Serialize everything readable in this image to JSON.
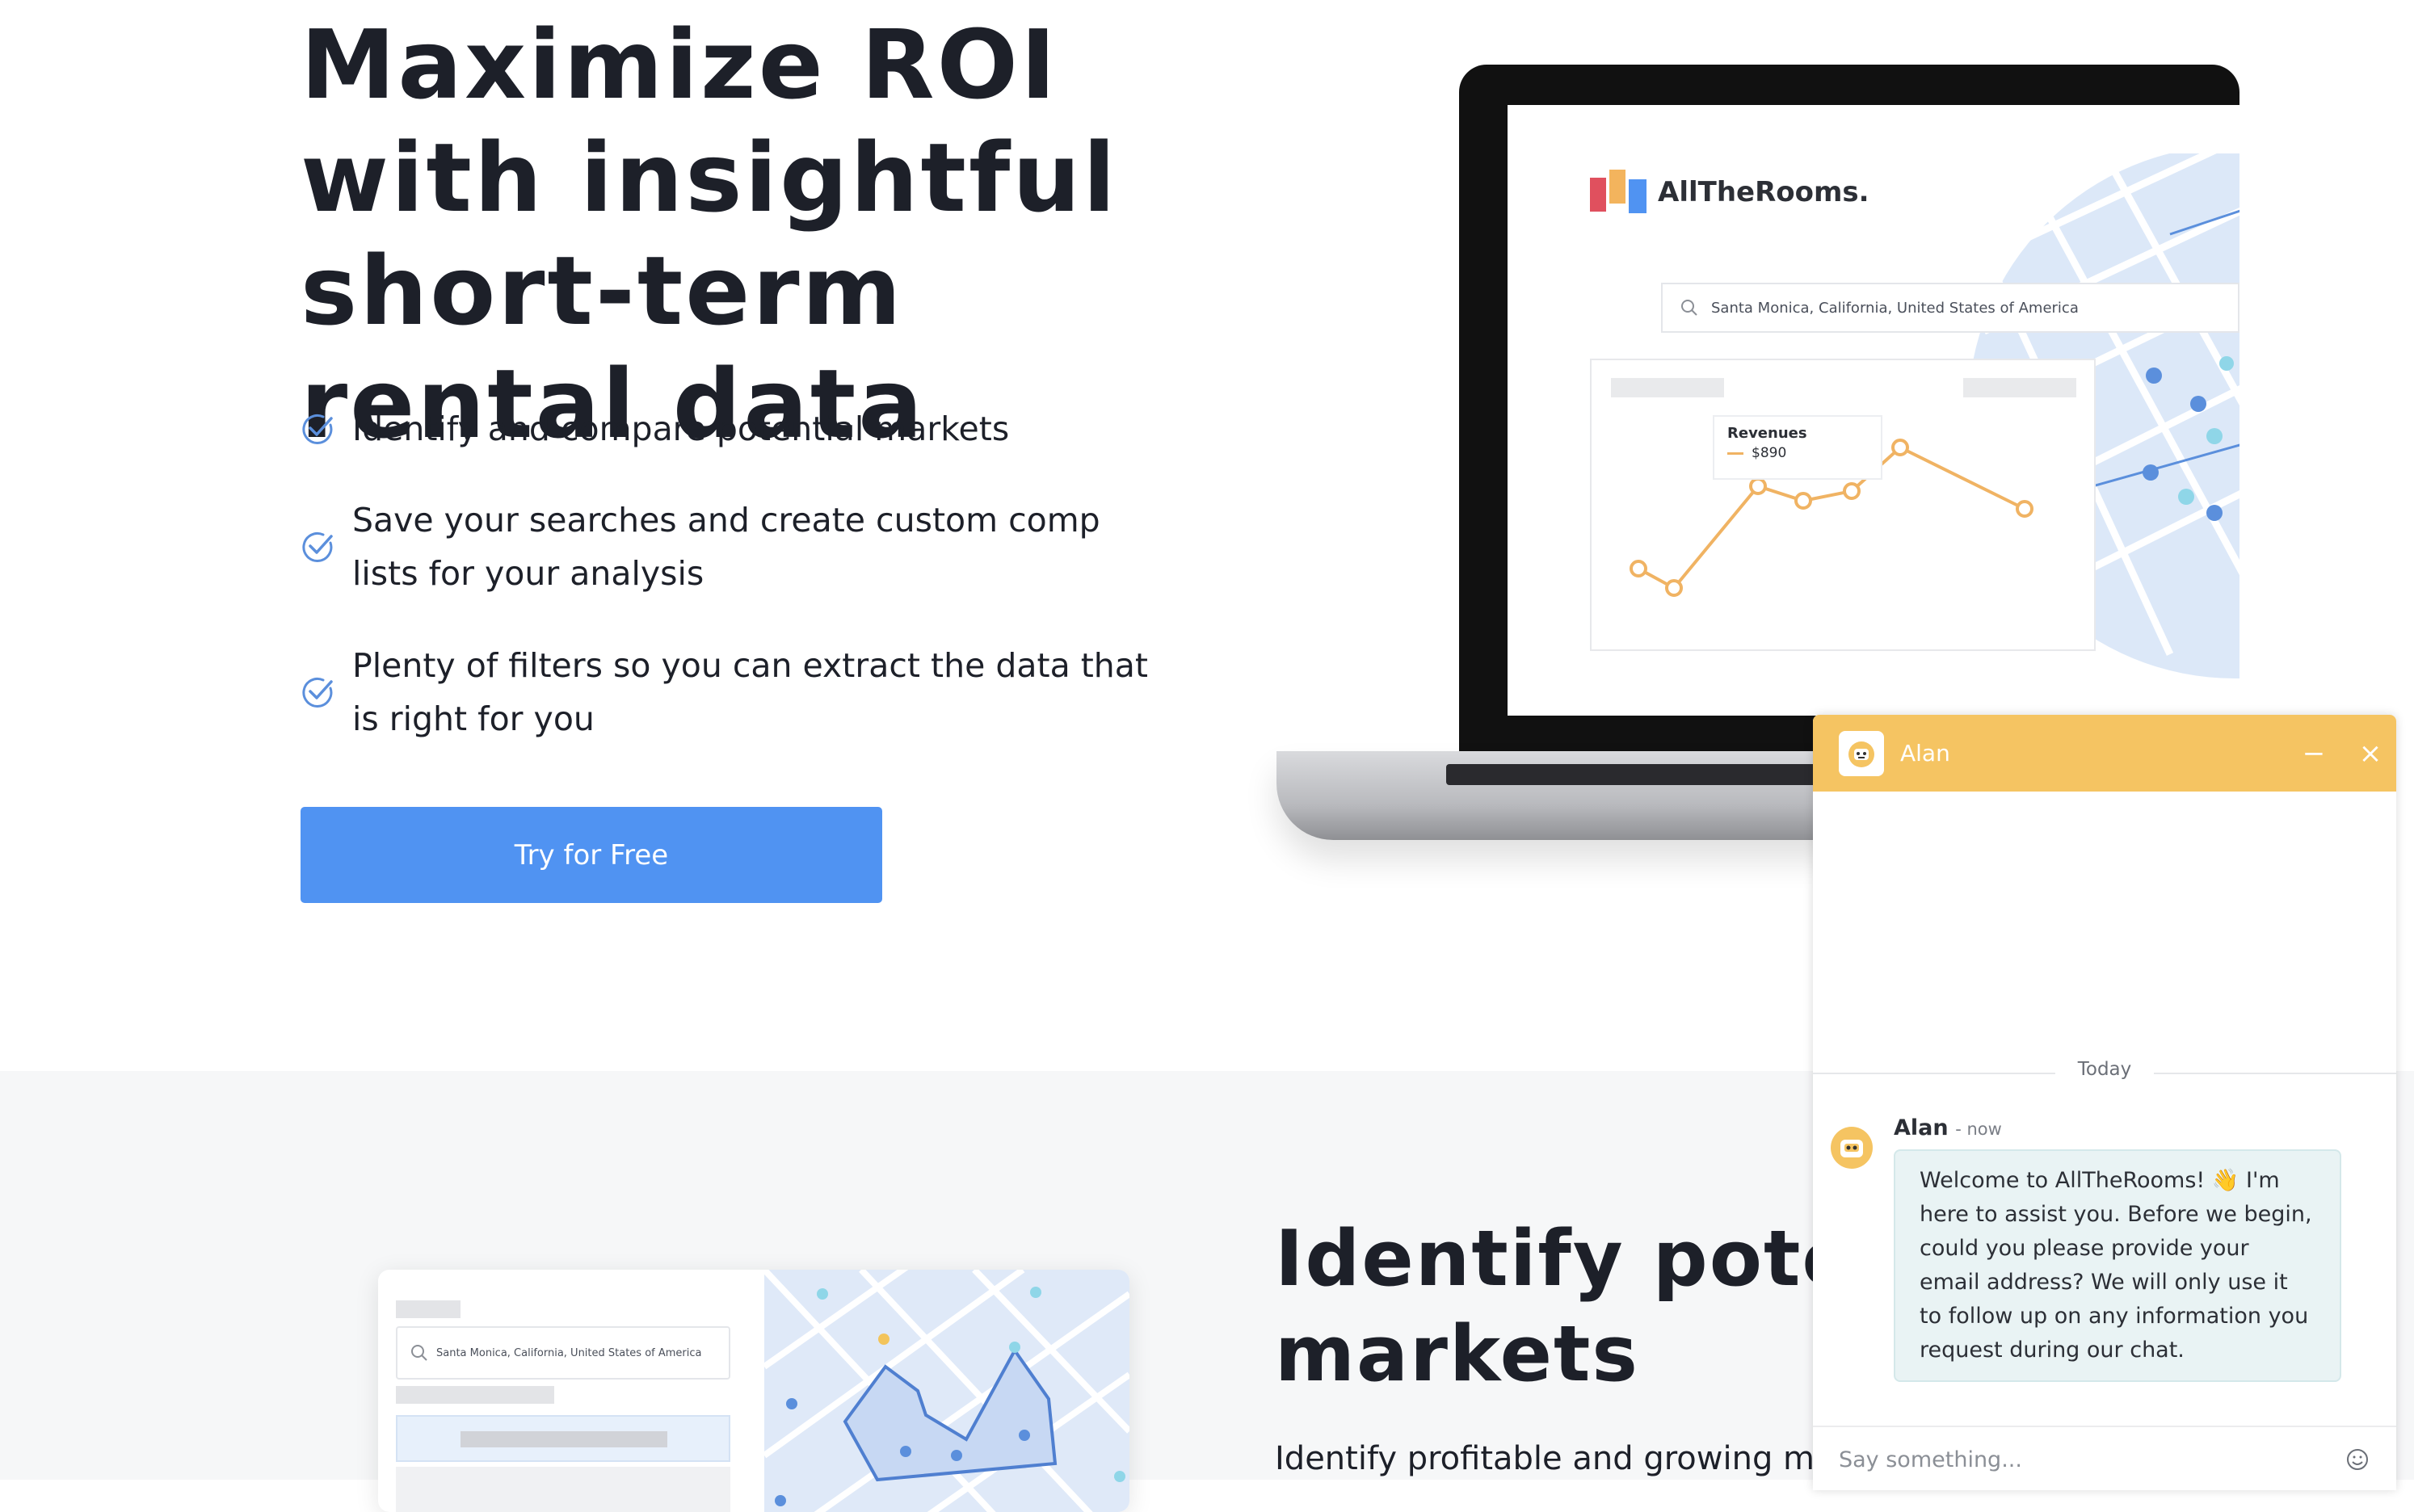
{
  "hero": {
    "title": "Maximize ROI with insightful short-term rental data",
    "features": [
      "Identify and compare potential markets",
      "Save your searches and create custom comp lists for your analysis",
      "Plenty of filters so you can extract the data that is right for you"
    ],
    "cta_label": "Try for Free"
  },
  "laptop_screen": {
    "brand": "AllTheRooms.",
    "search_text": "Santa Monica, California, United States of America",
    "tooltip_label": "Revenues",
    "tooltip_value": "$890"
  },
  "section2": {
    "title": "Identify potential markets",
    "subtitle": "Identify profitable and growing markets",
    "mock_search_text": "Santa Monica, California, United States of America"
  },
  "chat": {
    "agent_name": "Alan",
    "minimize_symbol": "−",
    "close_symbol": "×",
    "day_label": "Today",
    "message_sender": "Alan",
    "message_time": "- now",
    "message_text": "Welcome to AllTheRooms! 👋 I'm here to assist you. Before we begin, could you please provide your email address? We will only use it to follow up on any information you request during our chat.",
    "input_placeholder": "Say something..."
  },
  "colors": {
    "primary_button": "#5093f2",
    "chat_header": "#f5c462",
    "check_icon": "#5b8fdc",
    "chart_line": "#f0b363"
  },
  "icons": [
    "check-circle-icon",
    "search-icon",
    "robot-icon",
    "minimize-icon",
    "close-icon",
    "emoji-icon"
  ]
}
